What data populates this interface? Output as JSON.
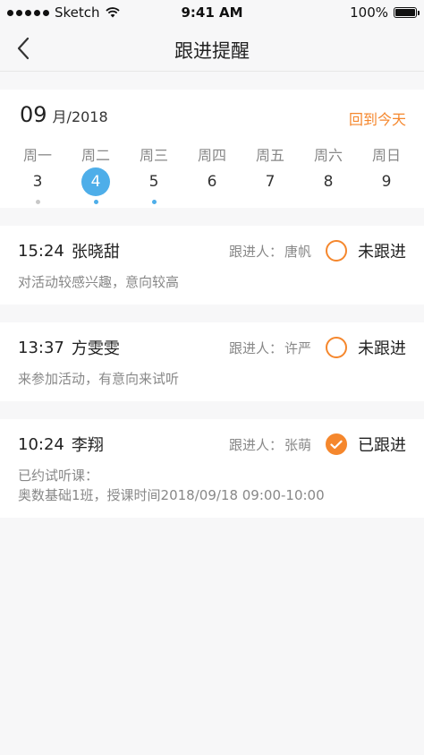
{
  "status_bar": {
    "carrier": "Sketch",
    "time": "9:41 AM",
    "battery": "100%"
  },
  "nav": {
    "title": "跟进提醒",
    "back_icon": "chevron-left-icon"
  },
  "calendar": {
    "month": "09",
    "month_suffix": "月/2018",
    "today_label": "回到今天",
    "days": [
      {
        "name": "周一",
        "num": "3",
        "selected": false,
        "dot": "#c8c8c8"
      },
      {
        "name": "周二",
        "num": "4",
        "selected": true,
        "dot": "#4eaee9"
      },
      {
        "name": "周三",
        "num": "5",
        "selected": false,
        "dot": "#4eaee9"
      },
      {
        "name": "周四",
        "num": "6",
        "selected": false,
        "dot": null
      },
      {
        "name": "周五",
        "num": "7",
        "selected": false,
        "dot": null
      },
      {
        "name": "周六",
        "num": "8",
        "selected": false,
        "dot": null
      },
      {
        "name": "周日",
        "num": "9",
        "selected": false,
        "dot": null
      }
    ]
  },
  "follower_label": "跟进人：",
  "records": [
    {
      "time": "15:24",
      "name": "张晓甜",
      "follower": "唐帆",
      "status": "未跟进",
      "done": false,
      "notes": [
        "对活动较感兴趣，意向较高"
      ]
    },
    {
      "time": "13:37",
      "name": "方雯雯",
      "follower": "许严",
      "status": "未跟进",
      "done": false,
      "notes": [
        "来参加活动，有意向来试听"
      ]
    },
    {
      "time": "10:24",
      "name": "李翔",
      "follower": "张萌",
      "status": "已跟进",
      "done": true,
      "notes": [
        "已约试听课：",
        "奥数基础1班，授课时间2018/09/18 09:00-10:00"
      ]
    }
  ],
  "colors": {
    "accent": "#f5872d",
    "selected_day": "#4eaee9"
  }
}
